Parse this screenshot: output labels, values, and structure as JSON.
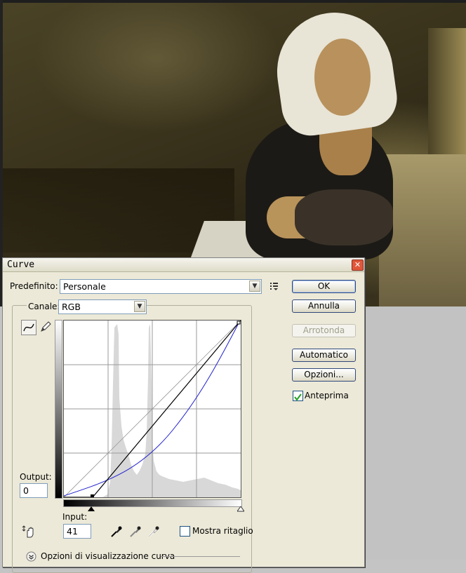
{
  "dialog": {
    "title": "Curve",
    "preset_label": "Predefinito:",
    "preset_value": "Personale",
    "channel_label": "Canale:",
    "channel_value": "RGB",
    "output_label": "Output:",
    "output_value": "0",
    "input_label": "Input:",
    "input_value": "41",
    "show_clipping_label": "Mostra ritaglio",
    "show_clipping_checked": false,
    "curve_display_options_label": "Opzioni di visualizzazione curva",
    "buttons": {
      "ok": "OK",
      "cancel": "Annulla",
      "smooth": "Arrotonda",
      "auto": "Automatico",
      "options": "Opzioni..."
    },
    "preview_label": "Anteprima",
    "preview_checked": true
  },
  "curve": {
    "input_range": [
      0,
      255
    ],
    "output_range": [
      0,
      255
    ],
    "black_point_input": 41,
    "black_point_output": 0,
    "active_curve_color": "#000000",
    "overlay_curve_color": "#2020d0"
  },
  "icons": {
    "close": "close-icon",
    "curve_tool": "curve-point-icon",
    "pencil_tool": "pencil-icon",
    "preset_menu": "preset-options-icon",
    "hand_adjust": "targeted-adjust-hand-icon",
    "black_eyedropper": "black-eyedropper-icon",
    "gray_eyedropper": "gray-eyedropper-icon",
    "white_eyedropper": "white-eyedropper-icon",
    "expand": "expand-chevron-icon"
  }
}
